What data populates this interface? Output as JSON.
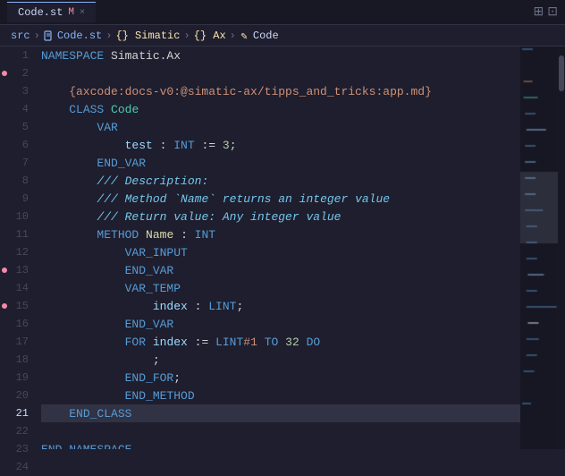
{
  "titleBar": {
    "tab_name": "Code.st",
    "tab_modified": "M",
    "tab_close": "×",
    "icons": [
      "⊞",
      "⊡"
    ]
  },
  "breadcrumb": {
    "items": [
      {
        "label": "src",
        "type": "text"
      },
      {
        "label": ">",
        "type": "sep"
      },
      {
        "label": "Code.st",
        "type": "file"
      },
      {
        "label": ">",
        "type": "sep"
      },
      {
        "label": "{} Simatic",
        "type": "folder"
      },
      {
        "label": ">",
        "type": "sep"
      },
      {
        "label": "{} Ax",
        "type": "folder"
      },
      {
        "label": ">",
        "type": "sep"
      },
      {
        "label": "✎ Code",
        "type": "active"
      }
    ]
  },
  "lines": [
    {
      "num": 1,
      "tokens": [
        {
          "t": "kw",
          "v": "NAMESPACE"
        },
        {
          "t": "ident",
          "v": " Simatic.Ax"
        }
      ]
    },
    {
      "num": 2,
      "tokens": []
    },
    {
      "num": 3,
      "tokens": [
        {
          "t": "ax-str",
          "v": "    {axcode:docs-v0:@simatic-ax/tipps_and_tricks:app.md}"
        }
      ]
    },
    {
      "num": 4,
      "tokens": [
        {
          "t": "ident",
          "v": "    "
        },
        {
          "t": "kw",
          "v": "CLASS"
        },
        {
          "t": "ident",
          "v": " "
        },
        {
          "t": "class-name",
          "v": "Code"
        }
      ]
    },
    {
      "num": 5,
      "tokens": [
        {
          "t": "ident",
          "v": "        "
        },
        {
          "t": "kw",
          "v": "VAR"
        }
      ]
    },
    {
      "num": 6,
      "tokens": [
        {
          "t": "ident",
          "v": "            "
        },
        {
          "t": "var-name",
          "v": "test"
        },
        {
          "t": "punct",
          "v": " : "
        },
        {
          "t": "type",
          "v": "INT"
        },
        {
          "t": "punct",
          "v": " := "
        },
        {
          "t": "num",
          "v": "3"
        },
        {
          "t": "punct",
          "v": ";"
        }
      ]
    },
    {
      "num": 7,
      "tokens": [
        {
          "t": "ident",
          "v": "        "
        },
        {
          "t": "kw",
          "v": "END_VAR"
        }
      ]
    },
    {
      "num": 8,
      "tokens": [
        {
          "t": "ident",
          "v": "        "
        },
        {
          "t": "comment-doc",
          "v": "/// Description:"
        }
      ]
    },
    {
      "num": 9,
      "tokens": [
        {
          "t": "ident",
          "v": "        "
        },
        {
          "t": "comment-doc",
          "v": "/// Method `Name` returns an integer value"
        }
      ]
    },
    {
      "num": 10,
      "tokens": [
        {
          "t": "ident",
          "v": "        "
        },
        {
          "t": "comment-doc",
          "v": "/// Return value: Any integer value"
        }
      ]
    },
    {
      "num": 11,
      "tokens": [
        {
          "t": "ident",
          "v": "        "
        },
        {
          "t": "kw",
          "v": "METHOD"
        },
        {
          "t": "ident",
          "v": " "
        },
        {
          "t": "method-name",
          "v": "Name"
        },
        {
          "t": "punct",
          "v": " : "
        },
        {
          "t": "type",
          "v": "INT"
        }
      ]
    },
    {
      "num": 12,
      "tokens": [
        {
          "t": "ident",
          "v": "            "
        },
        {
          "t": "kw",
          "v": "VAR_INPUT"
        }
      ]
    },
    {
      "num": 13,
      "tokens": [
        {
          "t": "ident",
          "v": "            "
        },
        {
          "t": "kw",
          "v": "END_VAR"
        }
      ]
    },
    {
      "num": 14,
      "tokens": [
        {
          "t": "ident",
          "v": "            "
        },
        {
          "t": "kw",
          "v": "VAR_TEMP"
        }
      ]
    },
    {
      "num": 15,
      "tokens": [
        {
          "t": "ident",
          "v": "                "
        },
        {
          "t": "var-name",
          "v": "index"
        },
        {
          "t": "punct",
          "v": " : "
        },
        {
          "t": "type",
          "v": "LINT"
        },
        {
          "t": "punct",
          "v": ";"
        }
      ]
    },
    {
      "num": 16,
      "tokens": [
        {
          "t": "ident",
          "v": "            "
        },
        {
          "t": "kw",
          "v": "END_VAR"
        }
      ]
    },
    {
      "num": 17,
      "tokens": [
        {
          "t": "ident",
          "v": "            "
        },
        {
          "t": "kw",
          "v": "FOR"
        },
        {
          "t": "ident",
          "v": " "
        },
        {
          "t": "var-name",
          "v": "index"
        },
        {
          "t": "punct",
          "v": " := "
        },
        {
          "t": "type",
          "v": "LINT"
        },
        {
          "t": "orange",
          "v": "#1"
        },
        {
          "t": "ident",
          "v": " "
        },
        {
          "t": "kw",
          "v": "TO"
        },
        {
          "t": "ident",
          "v": " "
        },
        {
          "t": "num",
          "v": "32"
        },
        {
          "t": "ident",
          "v": " "
        },
        {
          "t": "kw",
          "v": "DO"
        }
      ]
    },
    {
      "num": 18,
      "tokens": [
        {
          "t": "ident",
          "v": "                "
        },
        {
          "t": "punct",
          "v": ";"
        }
      ]
    },
    {
      "num": 19,
      "tokens": [
        {
          "t": "ident",
          "v": "            "
        },
        {
          "t": "kw",
          "v": "END_FOR"
        },
        {
          "t": "punct",
          "v": ";"
        }
      ]
    },
    {
      "num": 20,
      "tokens": [
        {
          "t": "ident",
          "v": "            "
        },
        {
          "t": "kw",
          "v": "END_METHOD"
        }
      ]
    },
    {
      "num": 21,
      "tokens": [
        {
          "t": "ident",
          "v": "    "
        },
        {
          "t": "kw",
          "v": "END_CLASS"
        }
      ]
    },
    {
      "num": 22,
      "tokens": []
    },
    {
      "num": 23,
      "tokens": [
        {
          "t": "kw",
          "v": "END_NAMESPACE"
        }
      ]
    },
    {
      "num": 24,
      "tokens": []
    }
  ],
  "dots": [
    2,
    13,
    15
  ],
  "activeLine": 21,
  "colors": {
    "bg": "#1e1e2e",
    "gutter_bg": "#1e1e2e",
    "line_num_inactive": "#45475a",
    "line_num_active": "#cdd6f4",
    "highlight": "#313244"
  }
}
